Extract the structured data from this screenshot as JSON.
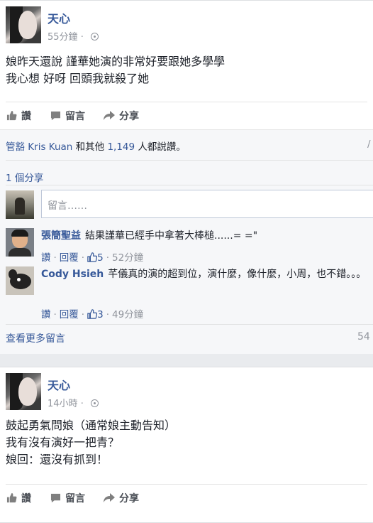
{
  "posts": [
    {
      "author": "天心",
      "time": "55分鐘",
      "body": [
        "娘昨天還說 謹華她演的非常好要跟她多學學",
        "我心想 好呀 回頭我就殺了她"
      ],
      "actions": {
        "like": "讚",
        "comment": "留言",
        "share": "分享"
      },
      "likes": {
        "name": "管豁 Kris Kuan",
        "mid": "和其他",
        "count": "1,149",
        "suffix": "人都說讚。",
        "end": "/"
      },
      "shares": "1 個分享",
      "composer_placeholder": "留言……",
      "comments": [
        {
          "name": "張簡聖益",
          "text": "結果謹華已經手中拿著大棒槌......= =\"",
          "reply_actions": {
            "like": "讚",
            "reply": "回覆",
            "likes": "5",
            "time": "52分鐘"
          }
        },
        {
          "name": "Cody Hsieh",
          "text": "芊儀真的演的超到位，演什麼，像什麼，小周，也不錯。。。",
          "reply_actions": {
            "like": "讚",
            "reply": "回覆",
            "likes": "3",
            "time": "49分鐘"
          }
        }
      ],
      "more_comments": "查看更多留言",
      "more_count": "54"
    },
    {
      "author": "天心",
      "time": "14小時",
      "body": [
        "鼓起勇氣問娘（通常娘主動告知）",
        "我有沒有演好一把青？",
        "娘回：還沒有抓到！"
      ],
      "actions": {
        "like": "讚",
        "comment": "留言",
        "share": "分享"
      }
    }
  ],
  "colors": {
    "link": "#365899",
    "muted": "#90949c",
    "text": "#1d2129",
    "bg": "#e9ebee"
  }
}
